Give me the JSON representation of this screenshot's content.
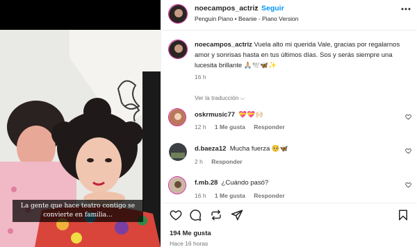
{
  "media": {
    "overlay_text": "La gente que hace teatro contigo se convierte en familia..."
  },
  "header": {
    "username": "noecampos_actriz",
    "separator": "•",
    "follow_label": "Seguir",
    "music": "Penguin Piano • Beanie - Piano Version"
  },
  "caption": {
    "username": "noecampos_actriz",
    "text": "Vuela alto mi querida Vale, gracias por regalarnos amor y sonrisas hasta en tus últimos días. Sos y serás siempre una lucesita brillante 🙏🏼🕊️🦋✨",
    "time": "16 h"
  },
  "see_translation": "Ver la traducción ⌵",
  "comments": [
    {
      "username": "oskrmusic77",
      "text": "💝💝🙌🏻",
      "time": "12 h",
      "likes": "1 Me gusta",
      "reply": "Responder"
    },
    {
      "username": "d.baeza12",
      "text": "Mucha fuerza 🥺🦋",
      "time": "2 h",
      "likes": "",
      "reply": "Responder"
    },
    {
      "username": "f.mb.28",
      "text": "¿Cuándo pasó?",
      "time": "16 h",
      "likes": "1 Me gusta",
      "reply": "Responder"
    }
  ],
  "footer": {
    "likes": "194 Me gusta",
    "ago": "Hace 16 horas"
  },
  "icons": {
    "like": "heart-icon",
    "comment": "comment-icon",
    "repost": "repost-icon",
    "share": "share-icon",
    "save": "bookmark-icon",
    "more": "more-horizontal-icon"
  },
  "colors": {
    "link": "#0095f6",
    "ring": "#d6249f",
    "muted": "#737373"
  }
}
